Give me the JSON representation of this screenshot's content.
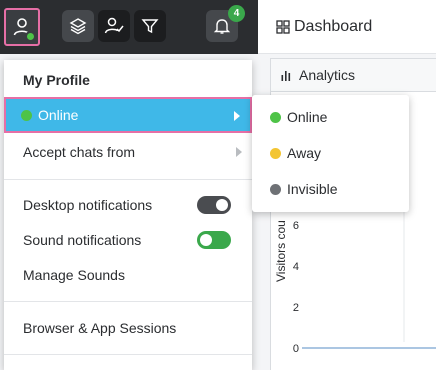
{
  "colors": {
    "online": "#4ec347",
    "away": "#f3c532",
    "invisible": "#6e7175",
    "highlight": "#3fb8e8",
    "toggle_off": "#4a4c50",
    "toggle_on": "#3aa84b"
  },
  "topbar": {
    "icons": [
      "user-icon",
      "layers-icon",
      "user-check-icon",
      "filter-icon",
      "bell-icon"
    ],
    "notification_count": "4"
  },
  "header": {
    "title": "Dashboard"
  },
  "tab": {
    "label": "Analytics"
  },
  "chart_data": {
    "type": "line",
    "ylabel": "Visitors cou",
    "y_ticks": [
      "6",
      "4",
      "2",
      "0"
    ],
    "values": [
      0,
      0
    ]
  },
  "menu": {
    "my_profile": "My Profile",
    "status_current": "Online",
    "accept_chats": "Accept chats from",
    "desktop_notifications": "Desktop notifications",
    "desktop_notifications_on": false,
    "sound_notifications": "Sound notifications",
    "sound_notifications_on": true,
    "manage_sounds": "Manage Sounds",
    "sessions": "Browser & App Sessions"
  },
  "submenu": {
    "items": [
      {
        "label": "Online",
        "status": "online"
      },
      {
        "label": "Away",
        "status": "away"
      },
      {
        "label": "Invisible",
        "status": "invisible"
      }
    ]
  }
}
